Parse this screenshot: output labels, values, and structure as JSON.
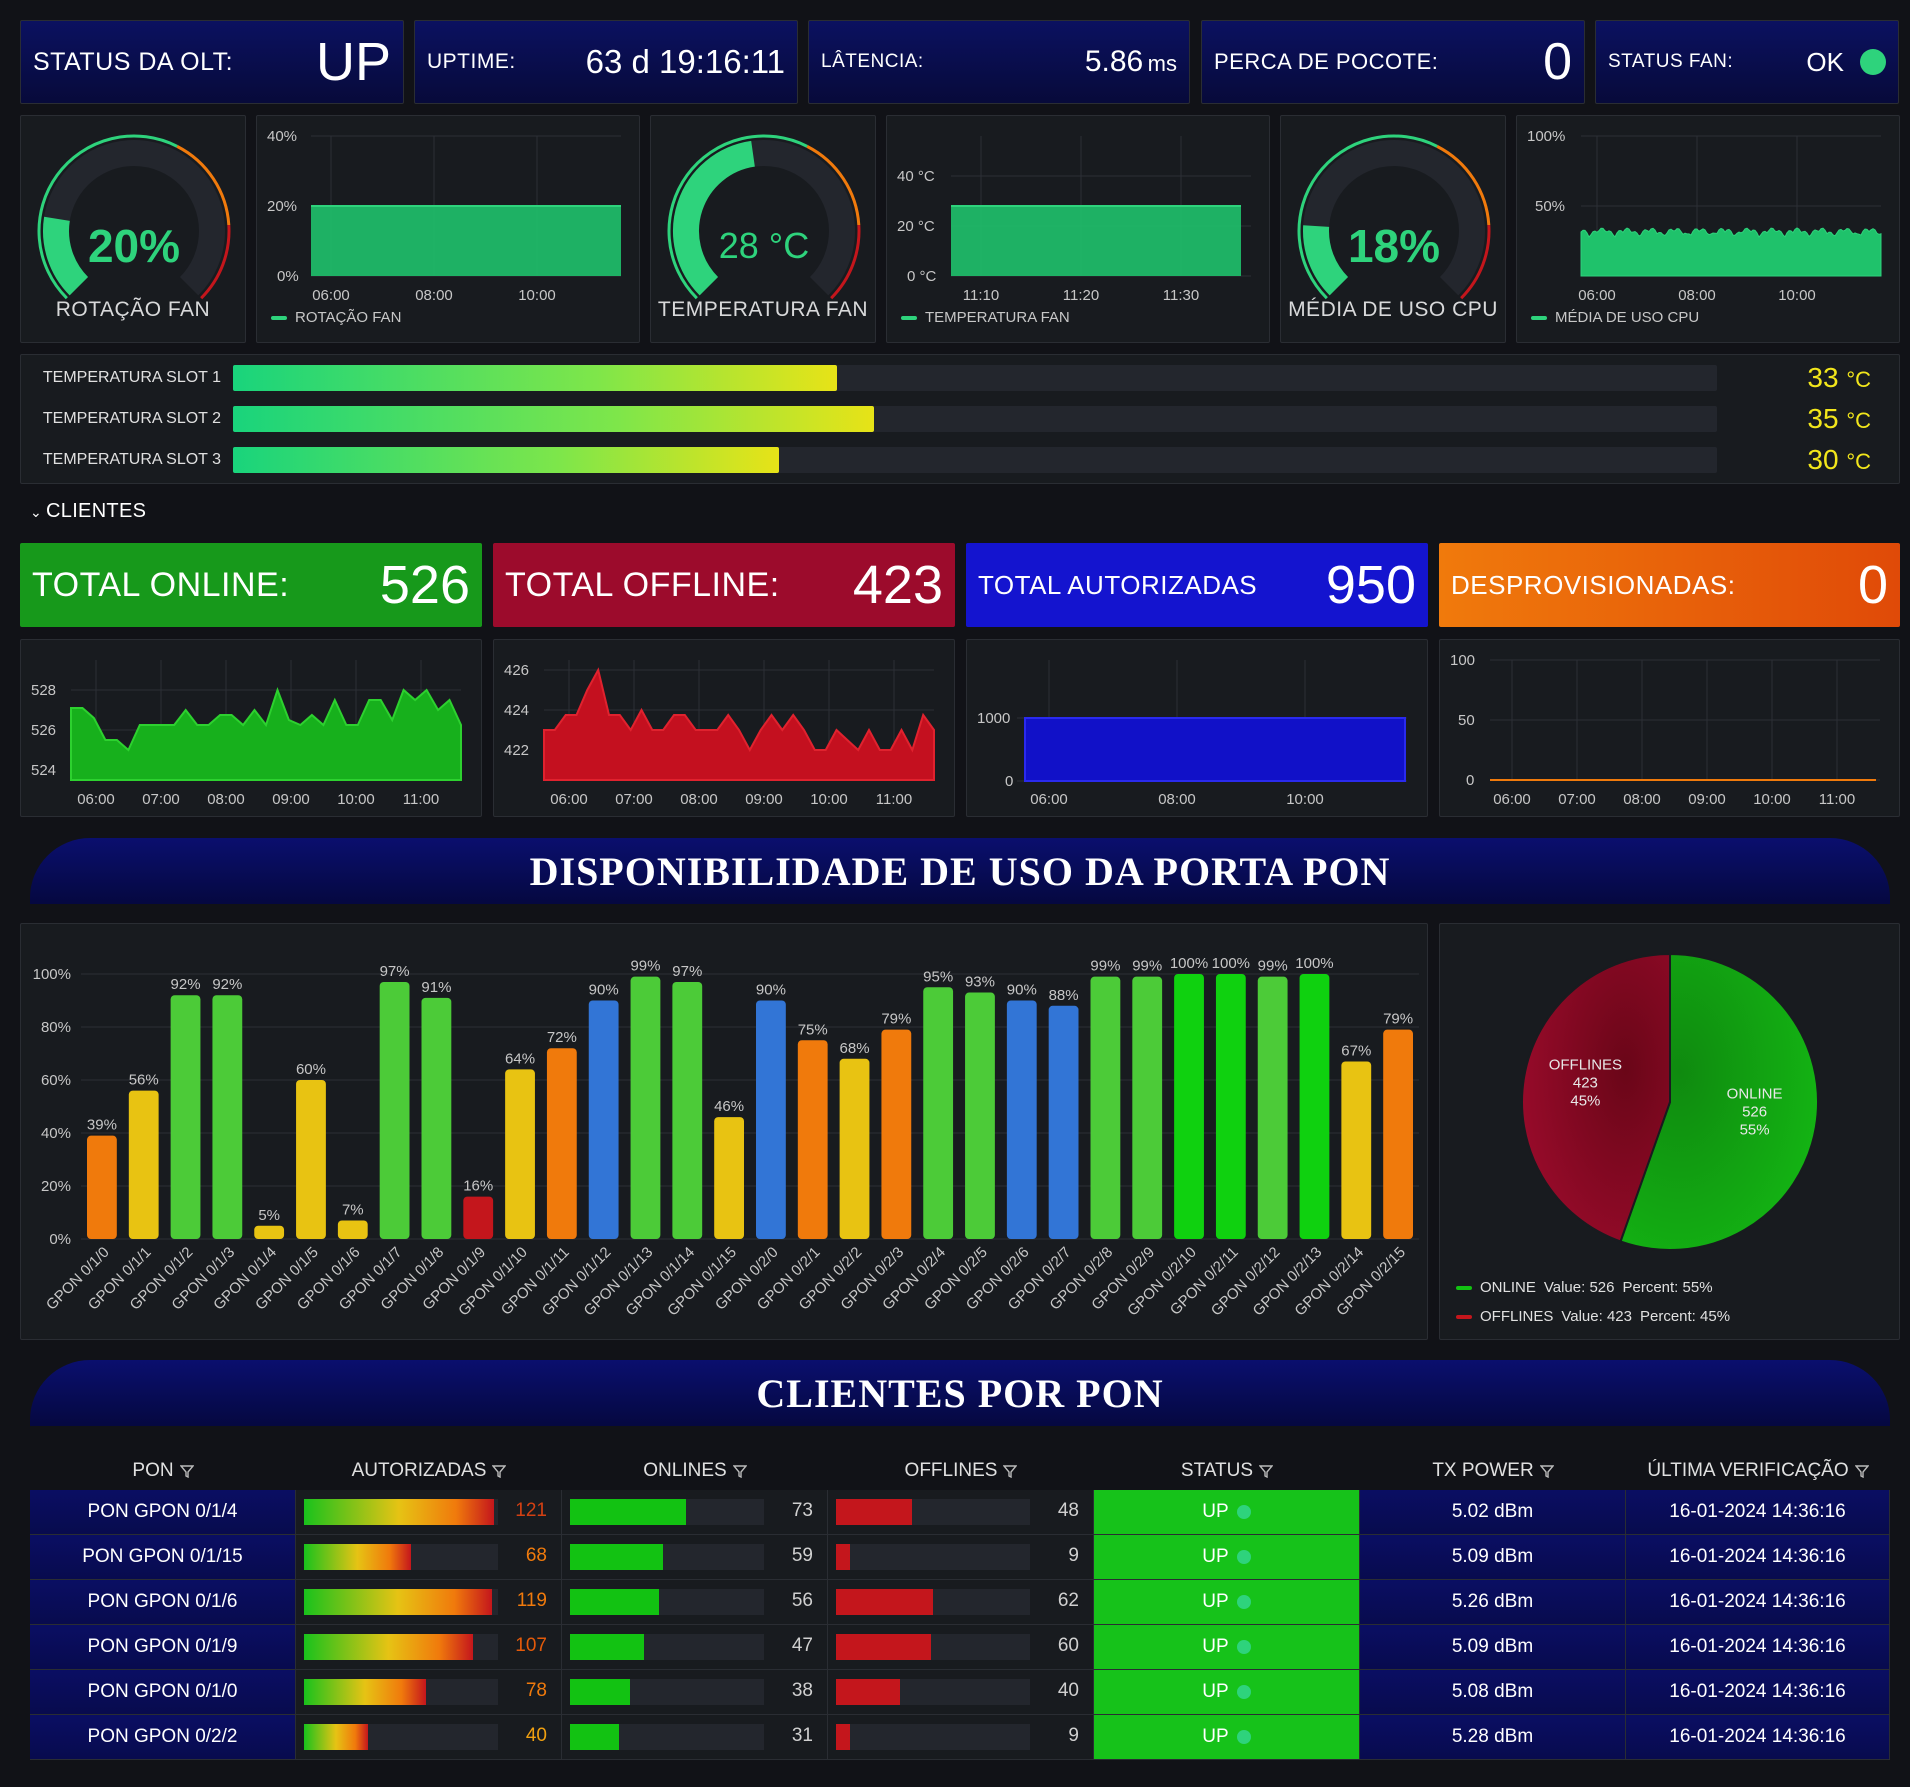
{
  "top_stats": {
    "olt_status": {
      "label": "STATUS DA OLT:",
      "value": "UP"
    },
    "uptime": {
      "label": "UPTIME:",
      "value": "63 d 19:16:11"
    },
    "latency": {
      "label": "LÂTENCIA:",
      "value": "5.86",
      "unit": "ms"
    },
    "packet_loss": {
      "label": "PERCA DE POCOTE:",
      "value": "0"
    },
    "fan_status": {
      "label": "STATUS FAN:",
      "value": "OK"
    }
  },
  "gauges": {
    "fan_rotation": {
      "value": "20%",
      "label": "ROTAÇÃO FAN",
      "fraction": 0.2
    },
    "fan_temperature": {
      "value": "28 °C",
      "label": "TEMPERATURA FAN",
      "fraction": 0.47
    },
    "cpu_usage": {
      "value": "18%",
      "label": "MÉDIA DE USO CPU",
      "fraction": 0.18
    }
  },
  "mini_charts": {
    "fan_rotation": {
      "y_ticks": [
        "40%",
        "20%",
        "0%"
      ],
      "x_ticks": [
        "06:00",
        "08:00",
        "10:00"
      ],
      "legend": "ROTAÇÃO FAN"
    },
    "fan_temperature": {
      "y_ticks": [
        "40 °C",
        "20 °C",
        "0 °C"
      ],
      "x_ticks": [
        "11:10",
        "11:20",
        "11:30"
      ],
      "legend": "TEMPERATURA FAN"
    },
    "cpu_usage": {
      "y_ticks": [
        "100%",
        "50%"
      ],
      "x_ticks": [
        "06:00",
        "08:00",
        "10:00"
      ],
      "legend": "MÉDIA DE USO CPU"
    }
  },
  "slots": [
    {
      "label": "TEMPERATURA SLOT 1",
      "value": "33",
      "unit": "°C",
      "fraction": 0.407
    },
    {
      "label": "TEMPERATURA SLOT 2",
      "value": "35",
      "unit": "°C",
      "fraction": 0.432
    },
    {
      "label": "TEMPERATURA SLOT 3",
      "value": "30",
      "unit": "°C",
      "fraction": 0.368
    }
  ],
  "clients_section": {
    "label": "CLIENTES",
    "chevron": "chevron-down-icon"
  },
  "client_stats": {
    "online": {
      "label": "TOTAL ONLINE:",
      "value": "526",
      "color": "#17991b"
    },
    "offline": {
      "label": "TOTAL OFFLINE:",
      "value": "423",
      "color": "#9c0b2c"
    },
    "authorized": {
      "label": "TOTAL AUTORIZADAS",
      "value": "950",
      "color": "#1414cf"
    },
    "deprovisioned": {
      "label": "DESPROVISIONADAS:",
      "value": "0",
      "color": "#e35a0a"
    }
  },
  "client_charts": {
    "online": {
      "y_ticks": [
        "528",
        "526",
        "524"
      ],
      "x_ticks": [
        "06:00",
        "07:00",
        "08:00",
        "09:00",
        "10:00",
        "11:00"
      ]
    },
    "offline": {
      "y_ticks": [
        "426",
        "424",
        "422"
      ],
      "x_ticks": [
        "06:00",
        "07:00",
        "08:00",
        "09:00",
        "10:00",
        "11:00"
      ]
    },
    "authorized": {
      "y_ticks": [
        "1000",
        "0"
      ],
      "x_ticks": [
        "06:00",
        "08:00",
        "10:00"
      ]
    },
    "deprovisioned": {
      "y_ticks": [
        "100",
        "50",
        "0"
      ],
      "x_ticks": [
        "06:00",
        "07:00",
        "08:00",
        "09:00",
        "10:00",
        "11:00"
      ]
    }
  },
  "banner_pon": "DISPONIBILIDADE DE USO DA PORTA PON",
  "banner_clients": "CLIENTES POR PON",
  "chart_data": [
    {
      "type": "bar",
      "title": "",
      "xlabel": "",
      "ylabel": "",
      "ylim": [
        0,
        100
      ],
      "y_ticks": [
        "0%",
        "20%",
        "40%",
        "60%",
        "80%",
        "100%"
      ],
      "categories": [
        "GPON 0/1/0",
        "GPON 0/1/1",
        "GPON 0/1/2",
        "GPON 0/1/3",
        "GPON 0/1/4",
        "GPON 0/1/5",
        "GPON 0/1/6",
        "GPON 0/1/7",
        "GPON 0/1/8",
        "GPON 0/1/9",
        "GPON 0/1/10",
        "GPON 0/1/11",
        "GPON 0/1/12",
        "GPON 0/1/13",
        "GPON 0/1/14",
        "GPON 0/1/15",
        "GPON 0/2/0",
        "GPON 0/2/1",
        "GPON 0/2/2",
        "GPON 0/2/3",
        "GPON 0/2/4",
        "GPON 0/2/5",
        "GPON 0/2/6",
        "GPON 0/2/7",
        "GPON 0/2/8",
        "GPON 0/2/9",
        "GPON 0/2/10",
        "GPON 0/2/11",
        "GPON 0/2/12",
        "GPON 0/2/13",
        "GPON 0/2/14",
        "GPON 0/2/15"
      ],
      "values": [
        39,
        56,
        92,
        92,
        5,
        60,
        7,
        97,
        91,
        16,
        64,
        72,
        90,
        99,
        97,
        46,
        90,
        75,
        68,
        79,
        95,
        93,
        90,
        88,
        99,
        99,
        100,
        100,
        99,
        100,
        67,
        79
      ],
      "labels": [
        "39%",
        "56%",
        "92%",
        "92%",
        "5%",
        "60%",
        "7%",
        "97%",
        "91%",
        "16%",
        "64%",
        "72%",
        "90%",
        "99%",
        "97%",
        "46%",
        "90%",
        "75%",
        "68%",
        "79%",
        "95%",
        "93%",
        "90%",
        "88%",
        "99%",
        "99%",
        "100%",
        "100%",
        "99%",
        "100%",
        "67%",
        "79%"
      ],
      "colors": [
        "#f07a0c",
        "#e8c312",
        "#4ccb38",
        "#4ccb38",
        "#e8c312",
        "#e8c312",
        "#e8c312",
        "#4ccb38",
        "#4ccb38",
        "#c4161c",
        "#e8c312",
        "#f07a0c",
        "#3275d6",
        "#4ccb38",
        "#4ccb38",
        "#e8c312",
        "#3275d6",
        "#f07a0c",
        "#e8c312",
        "#f07a0c",
        "#4ccb38",
        "#4ccb38",
        "#3275d6",
        "#3275d6",
        "#4ccb38",
        "#4ccb38",
        "#0fd10f",
        "#0fd10f",
        "#4ccb38",
        "#0fd10f",
        "#e8c312",
        "#f07a0c"
      ],
      "grid": true
    },
    {
      "type": "pie",
      "title": "",
      "slices": [
        {
          "name": "ONLINE",
          "value": 526,
          "percent": "55%",
          "color": "#12a312"
        },
        {
          "name": "OFFLINES",
          "value": 423,
          "percent": "45%",
          "color": "#8a0a24"
        }
      ],
      "legend": [
        {
          "name": "ONLINE",
          "text": "Value: 526",
          "percent_text": "Percent: 55%",
          "color": "#12a312"
        },
        {
          "name": "OFFLINES",
          "text": "Value: 423",
          "percent_text": "Percent: 45%",
          "color": "#c4161c"
        }
      ]
    }
  ],
  "table": {
    "headers": [
      "PON",
      "AUTORIZADAS",
      "ONLINES",
      "OFFLINES",
      "STATUS",
      "TX POWER",
      "ÚLTIMA VERIFICAÇÃO"
    ],
    "filter_icon": "filter-icon",
    "rows": [
      {
        "pon": "PON GPON 0/1/4",
        "auth": "121",
        "auth_frac": 0.98,
        "on": "73",
        "on_frac": 0.6,
        "off": "48",
        "off_frac": 0.39,
        "status": "UP",
        "tx": "5.02 dBm",
        "ts": "16-01-2024 14:36:16"
      },
      {
        "pon": "PON GPON 0/1/15",
        "auth": "68",
        "auth_frac": 0.55,
        "on": "59",
        "on_frac": 0.48,
        "off": "9",
        "off_frac": 0.07,
        "status": "UP",
        "tx": "5.09 dBm",
        "ts": "16-01-2024 14:36:16"
      },
      {
        "pon": "PON GPON 0/1/6",
        "auth": "119",
        "auth_frac": 0.97,
        "on": "56",
        "on_frac": 0.46,
        "off": "62",
        "off_frac": 0.5,
        "status": "UP",
        "tx": "5.26 dBm",
        "ts": "16-01-2024 14:36:16"
      },
      {
        "pon": "PON GPON 0/1/9",
        "auth": "107",
        "auth_frac": 0.87,
        "on": "47",
        "on_frac": 0.38,
        "off": "60",
        "off_frac": 0.49,
        "status": "UP",
        "tx": "5.09 dBm",
        "ts": "16-01-2024 14:36:16"
      },
      {
        "pon": "PON GPON 0/1/0",
        "auth": "78",
        "auth_frac": 0.63,
        "on": "38",
        "on_frac": 0.31,
        "off": "40",
        "off_frac": 0.33,
        "status": "UP",
        "tx": "5.08 dBm",
        "ts": "16-01-2024 14:36:16"
      },
      {
        "pon": "PON GPON 0/2/2",
        "auth": "40",
        "auth_frac": 0.33,
        "on": "31",
        "on_frac": 0.25,
        "off": "9",
        "off_frac": 0.07,
        "status": "UP",
        "tx": "5.28 dBm",
        "ts": "16-01-2024 14:36:16"
      }
    ]
  }
}
